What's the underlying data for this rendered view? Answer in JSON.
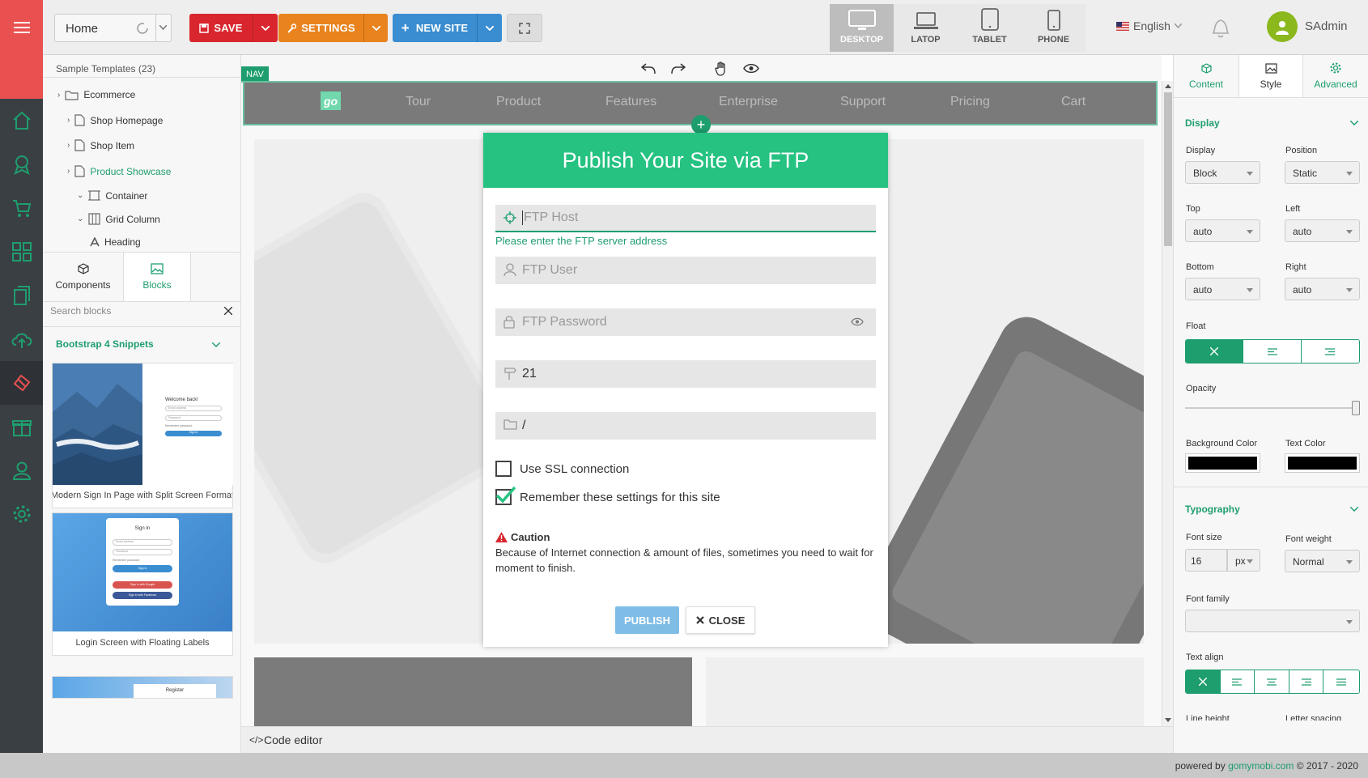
{
  "topbar": {
    "page_select": "Home",
    "save": "SAVE",
    "settings": "SETTINGS",
    "new_site": "NEW SITE",
    "devices": [
      "DESKTOP",
      "LATOP",
      "TABLET",
      "PHONE"
    ],
    "active_device": "DESKTOP",
    "language": "English",
    "user": "SAdmin"
  },
  "tree": {
    "title": "Sample Templates (23)",
    "items": [
      "Ecommerce",
      "Shop Homepage",
      "Shop Item",
      "Product Showcase",
      "Container",
      "Grid Column",
      "Heading"
    ]
  },
  "left_tabs": [
    "Components",
    "Blocks"
  ],
  "blocks": {
    "search_placeholder": "Search blocks",
    "group": "Bootstrap 4 Snippets",
    "cards": [
      "Modern Sign In Page with Split Screen Format",
      "Login Screen with Floating Labels"
    ],
    "thumb_text": {
      "welcome": "Welcome back!",
      "email": "Email address",
      "password": "Password",
      "remember": "Remember password",
      "signin": "Sign in",
      "signin_title": "Sign In",
      "google": "Sign in with Google",
      "facebook": "Sign in with Facebook",
      "register": "Register"
    }
  },
  "canvas": {
    "nav_tag": "NAV",
    "logo": "go",
    "nav_links": [
      "Tour",
      "Product",
      "Features",
      "Enterprise",
      "Support",
      "Pricing",
      "Cart"
    ],
    "code_editor": "Code editor"
  },
  "right_panel": {
    "tabs": [
      "Content",
      "Style",
      "Advanced"
    ],
    "display_section": "Display",
    "display_label": "Display",
    "display_value": "Block",
    "position_label": "Position",
    "position_value": "Static",
    "top_label": "Top",
    "top_value": "auto",
    "left_label": "Left",
    "left_value": "auto",
    "bottom_label": "Bottom",
    "bottom_value": "auto",
    "right_label": "Right",
    "right_value": "auto",
    "float_label": "Float",
    "opacity_label": "Opacity",
    "opacity_value": 1,
    "bg_color_label": "Background Color",
    "text_color_label": "Text Color",
    "typography_section": "Typography",
    "font_size_label": "Font size",
    "font_size_value": "16",
    "font_unit": "px",
    "font_weight_label": "Font weight",
    "font_weight_value": "Normal",
    "font_family_label": "Font family",
    "text_align_label": "Text align",
    "line_height_label": "Line height",
    "letter_spacing_label": "Letter spacing"
  },
  "modal": {
    "title": "Publish Your Site via FTP",
    "host_placeholder": "FTP Host",
    "host_hint": "Please enter the FTP server address",
    "user_placeholder": "FTP User",
    "password_placeholder": "FTP Password",
    "port": "21",
    "path": "/",
    "ssl_label": "Use SSL connection",
    "ssl_checked": false,
    "remember_label": "Remember these settings for this site",
    "remember_checked": true,
    "caution_title": "Caution",
    "caution_text": "Because of Internet connection & amount of files, sometimes you need to wait for moment to finish.",
    "publish": "PUBLISH",
    "close": "CLOSE"
  },
  "footer": {
    "prefix": "powered by ",
    "brand": "gomymobi.com",
    "suffix": " © 2017 - 2020"
  },
  "colors": {
    "brand_green": "#26c281",
    "accent_green": "#1e9e6e",
    "save_red": "#d9262e",
    "settings_orange": "#e8831e",
    "new_blue": "#3a8dd1"
  }
}
